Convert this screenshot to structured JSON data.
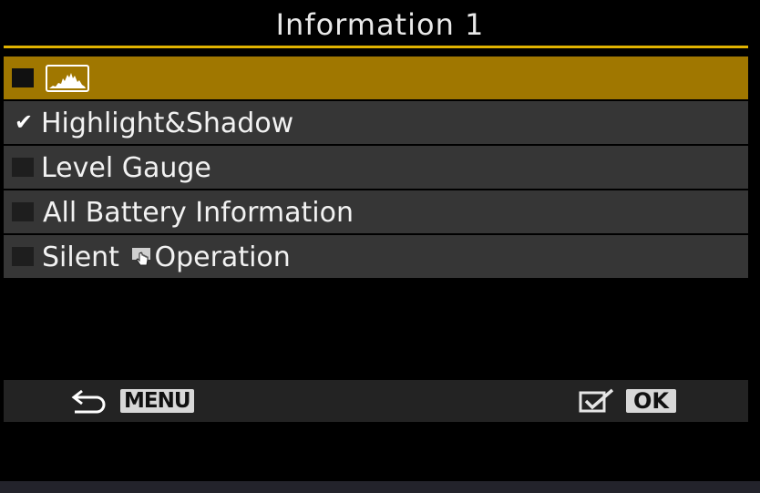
{
  "header": {
    "title": "Information 1"
  },
  "menu": {
    "items": [
      {
        "label": "",
        "icon": "histogram-icon",
        "checked": false,
        "selected": true
      },
      {
        "label": "Highlight&Shadow",
        "checked": true,
        "selected": false
      },
      {
        "label": "Level Gauge",
        "checked": false,
        "selected": false
      },
      {
        "label": "All Battery Information",
        "checked": false,
        "selected": false
      },
      {
        "label_before": "Silent ",
        "icon": "touch-icon",
        "label_after": "Operation",
        "checked": false,
        "selected": false
      }
    ]
  },
  "footer": {
    "back_icon": "return-arrow-icon",
    "back_label": "MENU",
    "confirm_icon": "checkbox-confirm-icon",
    "confirm_label": "OK"
  },
  "colors": {
    "accent": "#e0b200",
    "selected_row": "#a07700",
    "row": "#363636",
    "background": "#000000"
  }
}
